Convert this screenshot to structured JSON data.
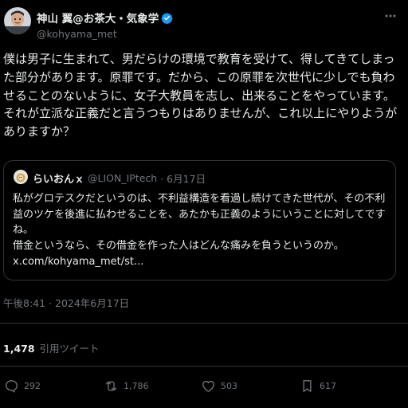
{
  "author": {
    "display_name": "神山 翼@お茶大・気象学",
    "handle": "@kohyama_met",
    "avatar_icon": "user-avatar",
    "verified_icon": "verified-badge-icon"
  },
  "tweet": {
    "paragraphs": [
      "僕は男子に生まれて、男だらけの環境で教育を受けて、得してきてしまった部分があります。原罪です。だから、この原罪を次世代に少しでも負わせることのないように、女子大教員を志し、出来ることをやっています。それが立派な正義だと言うつもりはありませんが、これ以上にやりようがありますか？"
    ]
  },
  "quote": {
    "display_name": "らいおんｘ",
    "handle": "@LION_IPtech",
    "date": "· 6月17日",
    "text_lines": [
      "私がグロテスクだというのは、不利益構造を看過し続けてきた世代が、その不利益のツケを後進に払わせることを、あたかも正義のようにいうことに対してですね。",
      "借金というなら、その借金を作った人はどんな痛みを負うというのか。",
      "x.com/kohyama_met/st..."
    ]
  },
  "timestamp": "午後8:41 · 2024年6月17日",
  "quote_count": {
    "number": "1,478",
    "label": "引用ツイート"
  },
  "actions": {
    "reply": "292",
    "retweet": "1,786",
    "like": "503",
    "bookmark": "617"
  },
  "colors": {
    "background": "#000000",
    "text": "#e7e9ea",
    "muted": "#71767b",
    "border": "#2f3336",
    "verified": "#1d9bf0"
  }
}
